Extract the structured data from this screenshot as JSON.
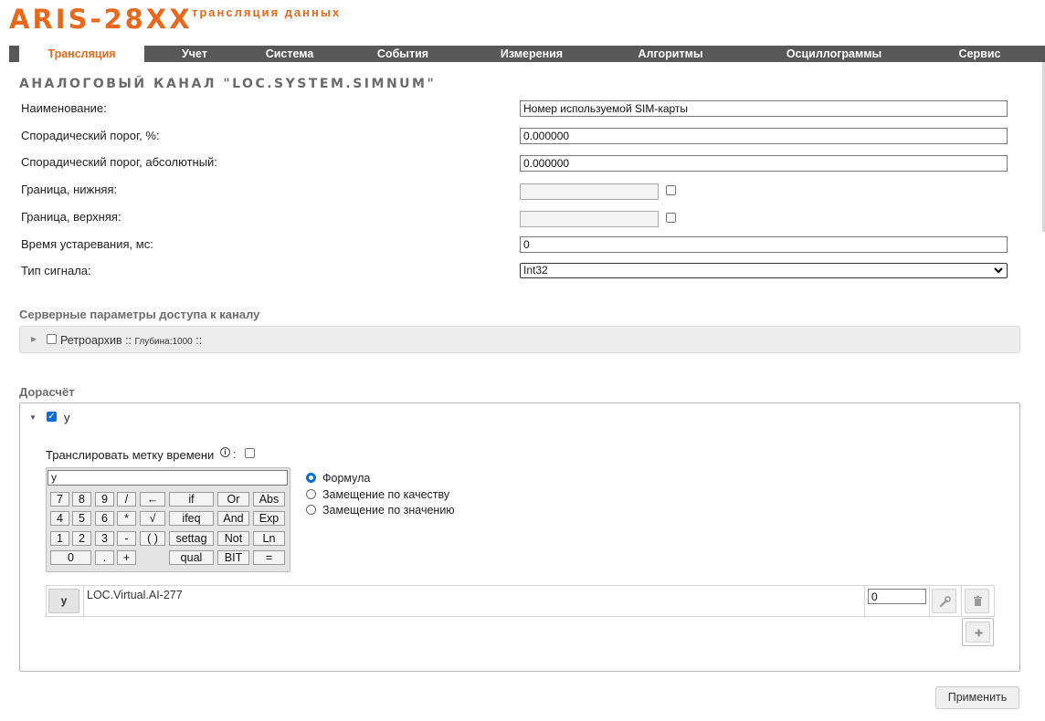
{
  "logo": {
    "main": "ARIS-28XX",
    "sub": "трансляция данных"
  },
  "nav": {
    "tabs": [
      "Трансляция",
      "Учет",
      "Система",
      "События",
      "Измерения",
      "Алгоритмы",
      "Осциллограммы",
      "Сервис"
    ],
    "active": "Трансляция"
  },
  "page_title": "АНАЛОГОВЫЙ КАНАЛ \"LOC.SYSTEM.SIMNUM\"",
  "form": {
    "name_label": "Наименование:",
    "name_value": "Номер используемой SIM-карты",
    "sporadic_pct_label": "Спорадический порог, %:",
    "sporadic_pct_value": "0.000000",
    "sporadic_abs_label": "Спорадический порог, абсолютный:",
    "sporadic_abs_value": "0.000000",
    "lower_bound_label": "Граница, нижняя:",
    "lower_bound_value": "",
    "upper_bound_label": "Граница, верхняя:",
    "upper_bound_value": "",
    "aging_label": "Время устаревания, мс:",
    "aging_value": "0",
    "signal_type_label": "Тип сигнала:",
    "signal_type_value": "Int32"
  },
  "server_section": {
    "title": "Серверные параметры доступа к каналу",
    "retro_label": "Ретроархив",
    "retro_sep": "::",
    "retro_depth": "Глубина:1000",
    "retro_end": "::"
  },
  "calc_section": {
    "title": "Дорасчёт",
    "var_checkbox_label": "y",
    "timestamp_label": "Транслировать метку времени",
    "timestamp_colon": ":",
    "formula": "y",
    "keys": [
      [
        "7",
        "8",
        "9",
        "/",
        "←",
        "if",
        "Or",
        "Abs"
      ],
      [
        "4",
        "5",
        "6",
        "*",
        "√",
        "ifeq",
        "And",
        "Exp"
      ],
      [
        "1",
        "2",
        "3",
        "-",
        "( )",
        "settag",
        "Not",
        "Ln"
      ],
      [
        "0",
        ".",
        "+",
        "qual",
        "BIT",
        "="
      ]
    ],
    "modes": [
      "Формула",
      "Замещение по качеству",
      "Замещение по значению"
    ],
    "selected_mode": "Формула",
    "variable": {
      "button": "y",
      "source": "LOC.Virtual.AI-277",
      "value": "0"
    }
  },
  "apply_label": "Применить",
  "colors": {
    "accent": "#e8691b",
    "nav_bg": "#585858",
    "checkbox": "#0a6cd6"
  }
}
